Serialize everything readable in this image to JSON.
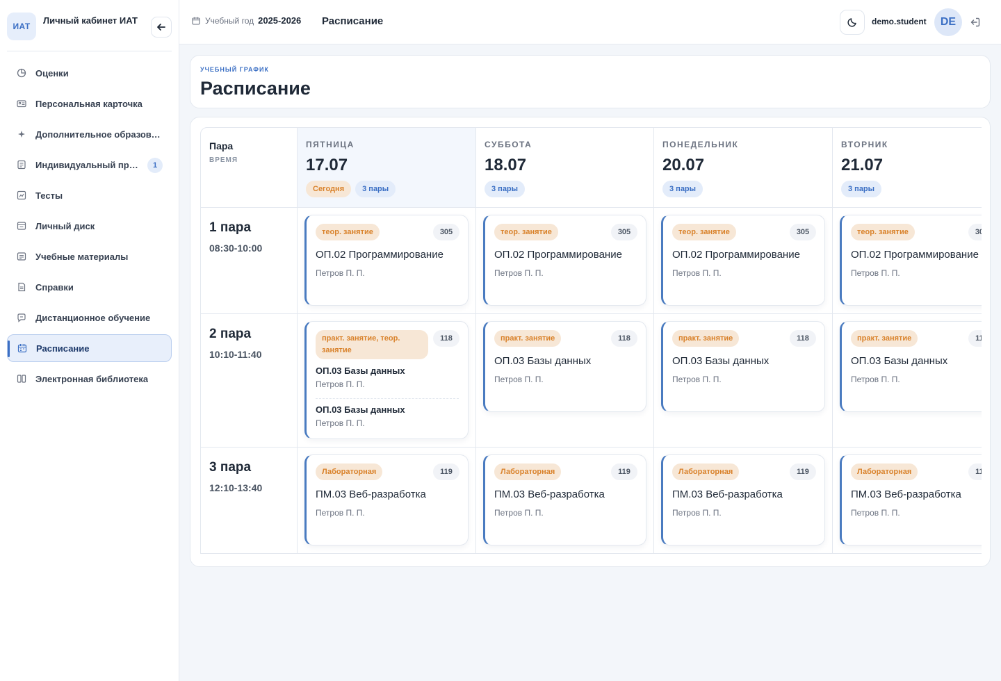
{
  "brand": {
    "logo": "ИАТ",
    "title": "Личный кабинет ИАТ"
  },
  "sidebar": {
    "items": [
      {
        "label": "Оценки",
        "icon": "pie-chart-icon"
      },
      {
        "label": "Персональная карточка",
        "icon": "id-card-icon"
      },
      {
        "label": "Дополнительное образование",
        "icon": "sparkle-icon"
      },
      {
        "label": "Индивидуальный проект",
        "icon": "document-icon",
        "badge": "1"
      },
      {
        "label": "Тесты",
        "icon": "test-icon"
      },
      {
        "label": "Личный диск",
        "icon": "drive-icon"
      },
      {
        "label": "Учебные материалы",
        "icon": "materials-icon"
      },
      {
        "label": "Справки",
        "icon": "certificate-icon"
      },
      {
        "label": "Дистанционное обучение",
        "icon": "chat-icon"
      },
      {
        "label": "Расписание",
        "icon": "calendar-icon",
        "active": true
      },
      {
        "label": "Электронная библиотека",
        "icon": "book-icon"
      }
    ]
  },
  "topbar": {
    "year_label": "Учебный год",
    "year_value": "2025-2026",
    "page": "Расписание",
    "user": "demo.student",
    "avatar": "DE"
  },
  "header": {
    "eyebrow": "УЧЕБНЫЙ ГРАФИК",
    "title": "Расписание"
  },
  "schedule": {
    "head_title": "Пара",
    "head_sub": "ВРЕМЯ",
    "days": [
      {
        "name": "ПЯТНИЦА",
        "date": "17.07",
        "today": "Сегодня",
        "count": "3 пары"
      },
      {
        "name": "СУББОТА",
        "date": "18.07",
        "count": "3 пары"
      },
      {
        "name": "ПОНЕДЕЛЬНИК",
        "date": "20.07",
        "count": "3 пары"
      },
      {
        "name": "ВТОРНИК",
        "date": "21.07",
        "count": "3 пары"
      }
    ],
    "slots": [
      {
        "name": "1 пара",
        "time": "08:30-10:00"
      },
      {
        "name": "2 пара",
        "time": "10:10-11:40"
      },
      {
        "name": "3 пара",
        "time": "12:10-13:40"
      }
    ],
    "lessons": {
      "s1": {
        "type": "теор. занятие",
        "room": "305",
        "subject": "ОП.02 Программирование",
        "teacher": "Петров П. П."
      },
      "s2": {
        "type": "практ. занятие",
        "room": "118",
        "subject": "ОП.03 Базы данных",
        "teacher": "Петров П. П."
      },
      "s2_multi": {
        "type": "практ. занятие, теор. занятие",
        "room": "118",
        "first_subject": "ОП.03 Базы данных",
        "first_teacher": "Петров П. П.",
        "second_subject": "ОП.03 Базы данных",
        "second_teacher": "Петров П. П."
      },
      "s3": {
        "type": "Лабораторная",
        "room": "119",
        "subject": "ПМ.03 Веб-разработка",
        "teacher": "Петров П. П."
      }
    }
  },
  "colors": {
    "accent": "#3b6fc4",
    "tag_bg": "#f7e7d6",
    "tag_text": "#d9822b",
    "active_bg": "#e8effb"
  }
}
